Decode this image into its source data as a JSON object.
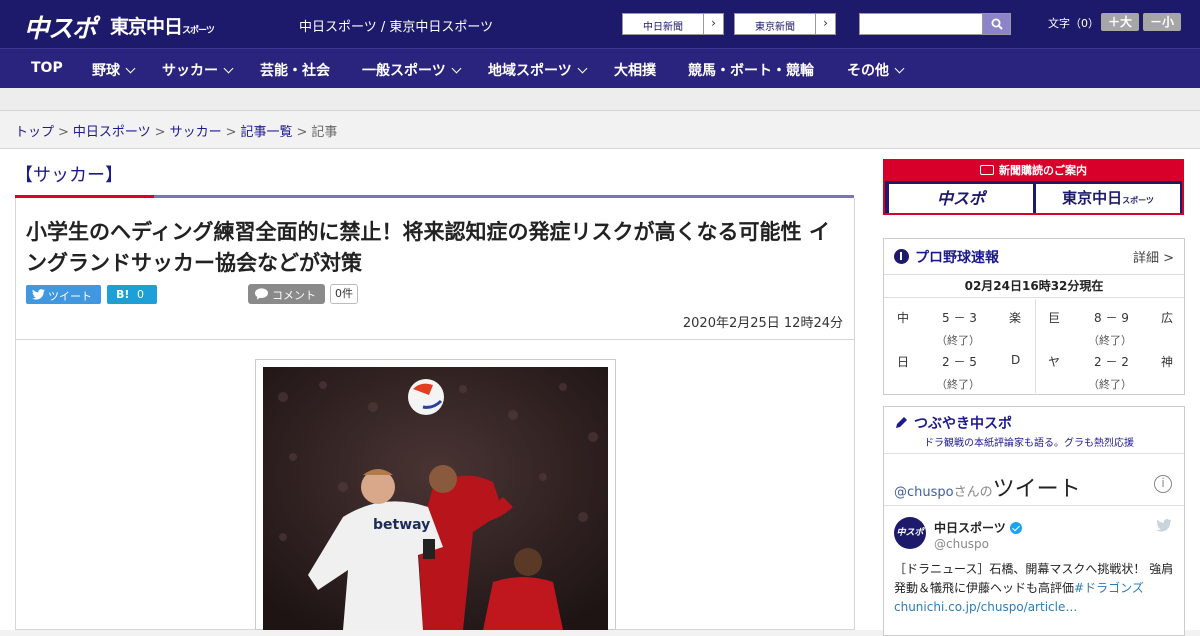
{
  "header": {
    "logo_chuspo": "中スポ",
    "logo_tokyo": "東京中日",
    "logo_tokyo_small": "スポーツ",
    "site_links": "中日スポーツ / 東京中日スポーツ",
    "paper_buttons": [
      {
        "label": "中日新聞",
        "arrow": "›"
      },
      {
        "label": "東京新聞",
        "arrow": "›"
      }
    ],
    "search_placeholder": "",
    "font_size_label": "文字（0）",
    "font_larger": "＋大",
    "font_smaller": "－小"
  },
  "nav": {
    "items": [
      {
        "label": "TOP",
        "dropdown": false
      },
      {
        "label": "野球",
        "dropdown": true
      },
      {
        "label": "サッカー",
        "dropdown": true
      },
      {
        "label": "芸能・社会",
        "dropdown": false
      },
      {
        "label": "一般スポーツ",
        "dropdown": true
      },
      {
        "label": "地域スポーツ",
        "dropdown": true
      },
      {
        "label": "大相撲",
        "dropdown": false
      },
      {
        "label": "競馬・ボート・競輪",
        "dropdown": false
      },
      {
        "label": "その他",
        "dropdown": true
      }
    ]
  },
  "breadcrumb": {
    "items": [
      "トップ",
      "中日スポーツ",
      "サッカー",
      "記事一覧"
    ],
    "current": "記事",
    "separator": ">"
  },
  "article": {
    "category": "【サッカー】",
    "headline": "小学生のヘディング練習全面的に禁止！将来認知症の発症リスクが高くなる可能性 イングランドサッカー協会などが対策",
    "tweet_label": "ツイート",
    "hatena_label": "B!",
    "hatena_count": "0",
    "comment_label": "コメント",
    "comment_count": "0件",
    "date": "2020年2月25日 12時24分",
    "photo_jersey_text": "betway"
  },
  "sidebar": {
    "subscription": {
      "heading": "新聞購読のご案内",
      "logo_left": "中スポ",
      "logo_right": "東京中日",
      "logo_right_small": "スポーツ"
    },
    "baseball": {
      "title": "プロ野球速報",
      "detail": "詳細 >",
      "time": "02月24日16時32分現在",
      "games": [
        {
          "home": "中",
          "score": "5 － 3",
          "away": "楽",
          "status": "（終了）"
        },
        {
          "home": "巨",
          "score": "8 － 9",
          "away": "広",
          "status": "（終了）"
        },
        {
          "home": "日",
          "score": "2 － 5",
          "away": "D",
          "status": "（終了）"
        },
        {
          "home": "ヤ",
          "score": "2 － 2",
          "away": "神",
          "status": "（終了）"
        }
      ]
    },
    "tweets": {
      "title": "つぶやき中スポ",
      "subtitle": "ドラ観戦の本紙評論家も語る。グラも熱烈応援",
      "handle_head": "@chuspo",
      "handle_san": "さんの",
      "handle_big": "ツイート",
      "info_icon": "i",
      "account_name": "中日スポーツ",
      "account_user": "@chuspo",
      "avatar_text": "中スポ",
      "body_text": "［ドラニュース］石橋、開幕マスクへ挑戦状！ 強肩発動＆犠飛に伊藤ヘッドも高評価",
      "body_tag": "#ドラゴンズ",
      "body_link": "chunichi.co.jp/chuspo/article…"
    }
  },
  "colors": {
    "header_bg": "#1d1a6b",
    "nav_bg": "#2a247e",
    "accent_red": "#d8002a",
    "link_blue": "#1d1a8f"
  }
}
